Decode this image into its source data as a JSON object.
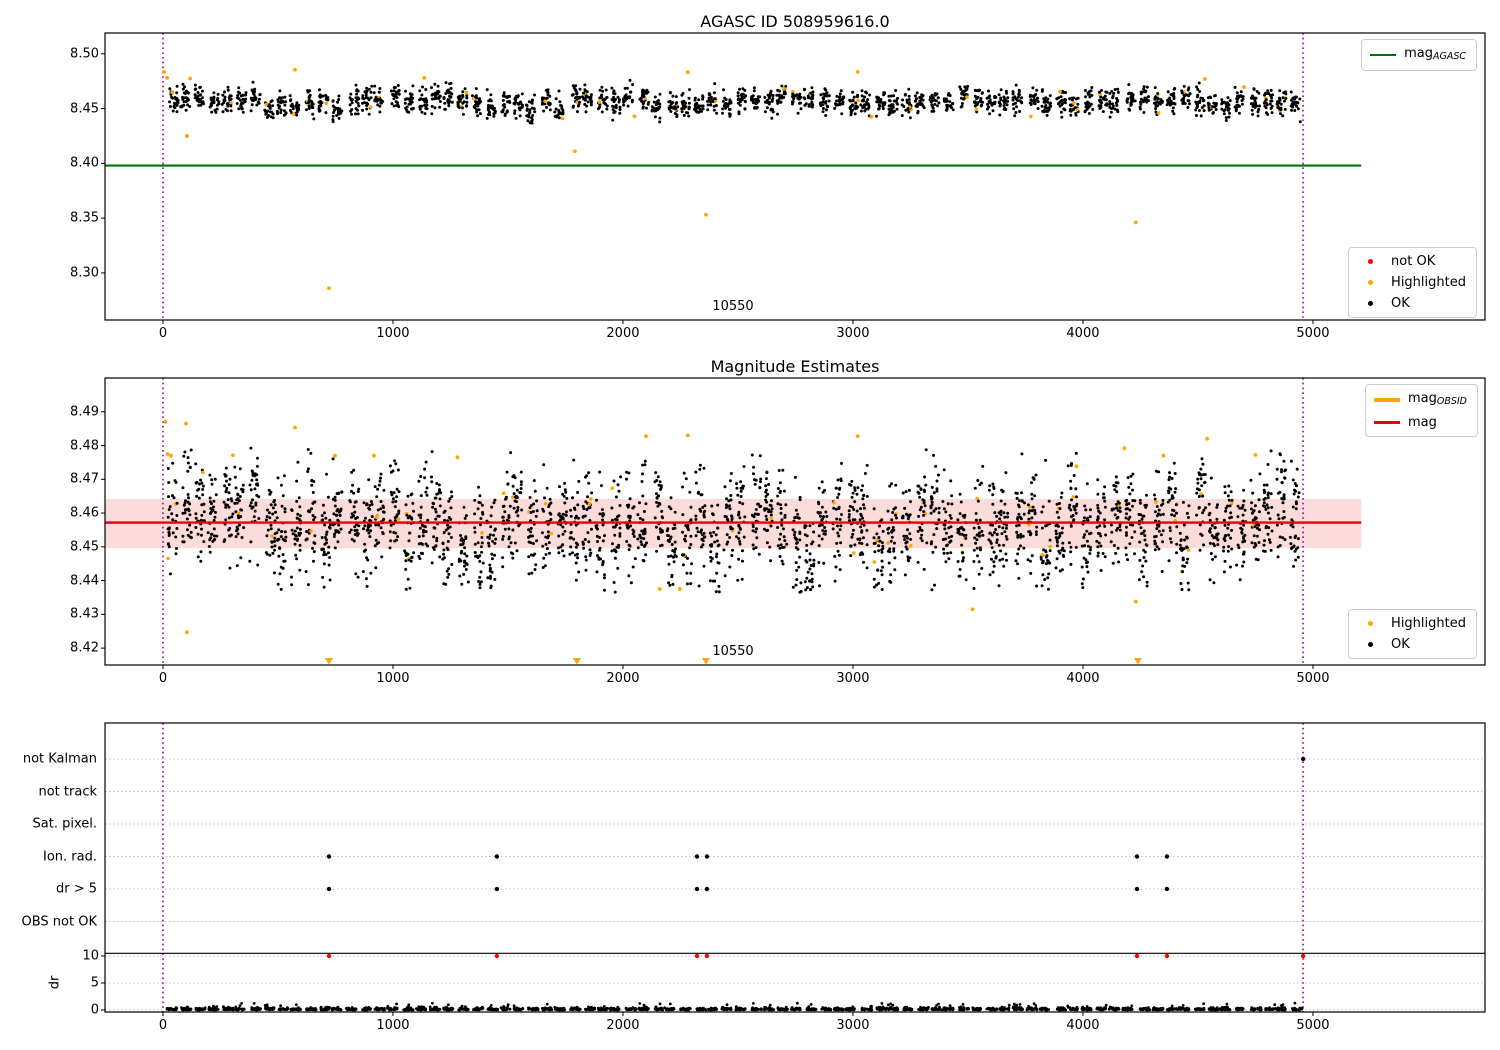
{
  "colors": {
    "ok": "#000000",
    "highlighted": "#ffa500",
    "not_ok": "#ff0000",
    "mag_agasc_line": "#007000",
    "mag_line": "#ee0000",
    "mag_obsid_line": "#ffa500",
    "band_fill": "#fbdcda",
    "vline": "#990099",
    "grid": "#bbbbbb"
  },
  "chart_data": [
    {
      "type": "scatter",
      "title": "AGASC ID 508959616.0",
      "xlim": [
        -252,
        5748
      ],
      "ylim": [
        8.257,
        8.519
      ],
      "xticks": [
        0,
        1000,
        2000,
        3000,
        4000,
        5000
      ],
      "yticks": [
        8.3,
        8.35,
        8.4,
        8.45,
        8.5
      ],
      "vlines": [
        0,
        4957
      ],
      "hline": {
        "y": 8.398,
        "x0": -252,
        "x1": 5210
      },
      "annotation": {
        "text": "10550",
        "x": 2480
      },
      "legend_top": [
        {
          "label": "mag",
          "sub": "AGASC"
        }
      ],
      "legend_bottom": [
        {
          "label": "not OK"
        },
        {
          "label": "Highlighted"
        },
        {
          "label": "OK"
        }
      ],
      "gen": {
        "seed": 421,
        "clusters": 82,
        "x0": 8,
        "x1": 4958,
        "per_cluster": 26,
        "mean": 8.456,
        "cluster_sd": 0.0028,
        "point_sd": 0.0058,
        "ymin": 8.436,
        "ymax": 8.492,
        "highlighted_frac": 0.016
      },
      "highlighted_points": [
        [
          104,
          8.425
        ],
        [
          722,
          8.286
        ],
        [
          1791,
          8.411
        ],
        [
          2361,
          8.353
        ],
        [
          4230,
          8.346
        ],
        [
          5,
          8.4835
        ],
        [
          18,
          8.478
        ],
        [
          40,
          8.465
        ],
        [
          118,
          8.4775
        ],
        [
          574,
          8.4855
        ],
        [
          1136,
          8.478
        ],
        [
          2282,
          8.4832
        ],
        [
          3020,
          8.4835
        ],
        [
          1320,
          8.4645
        ],
        [
          2700,
          8.468
        ],
        [
          3900,
          8.4655
        ],
        [
          4700,
          8.4695
        ],
        [
          2050,
          8.443
        ],
        [
          3080,
          8.4425
        ],
        [
          4530,
          8.477
        ]
      ]
    },
    {
      "type": "scatter",
      "title": "Magnitude Estimates",
      "xlim": [
        -252,
        5748
      ],
      "ylim": [
        8.415,
        8.5
      ],
      "xticks": [
        0,
        1000,
        2000,
        3000,
        4000,
        5000
      ],
      "yticks": [
        8.42,
        8.43,
        8.44,
        8.45,
        8.46,
        8.47,
        8.48,
        8.49
      ],
      "vlines": [
        0,
        4957
      ],
      "hline": {
        "y": 8.4572,
        "x0": -252,
        "x1": 5210
      },
      "band": {
        "y0": 8.4496,
        "y1": 8.4642,
        "x0": -252,
        "x1": 5210
      },
      "annotation": {
        "text": "10550",
        "x": 2480
      },
      "legend_top": [
        {
          "label": "mag",
          "sub": "OBSID"
        },
        {
          "label": "mag",
          "sub": ""
        }
      ],
      "legend_bottom": [
        {
          "label": "Highlighted"
        },
        {
          "label": "OK"
        }
      ],
      "clipped_low_x": [
        722,
        1800,
        2361,
        4239
      ],
      "gen": {
        "seed": 887,
        "clusters": 82,
        "x0": 8,
        "x1": 4958,
        "per_cluster": 34,
        "mean": 8.457,
        "cluster_sd": 0.0035,
        "point_sd": 0.0075,
        "ymin": 8.4365,
        "ymax": 8.4795,
        "highlighted_frac": 0.013
      },
      "highlighted_points": [
        [
          104,
          8.4247
        ],
        [
          100,
          8.4865
        ],
        [
          10,
          8.487
        ],
        [
          20,
          8.4775
        ],
        [
          35,
          8.477
        ],
        [
          574,
          8.4853
        ],
        [
          748,
          8.477
        ],
        [
          917,
          8.477
        ],
        [
          2100,
          8.4828
        ],
        [
          2282,
          8.483
        ],
        [
          3020,
          8.4828
        ],
        [
          2160,
          8.4375
        ],
        [
          2247,
          8.4375
        ],
        [
          3520,
          8.4315
        ],
        [
          4230,
          8.4338
        ],
        [
          4540,
          8.482
        ],
        [
          4750,
          8.4772
        ],
        [
          4350,
          8.477
        ],
        [
          1280,
          8.4765
        ],
        [
          4180,
          8.4792
        ]
      ]
    },
    {
      "type": "flags",
      "flag_labels": [
        "not Kalman",
        "not track",
        "Sat. pixel.",
        "Ion. rad.",
        "dr > 5",
        "OBS not OK"
      ],
      "dr_ticks": [
        10,
        5,
        0
      ],
      "dr_axis_label": "dr",
      "xticks": [
        0,
        1000,
        2000,
        3000,
        4000,
        5000
      ],
      "vlines": [
        0,
        4957
      ],
      "separator_dr": 10.5,
      "flag_points": {
        "Ion. rad.": [
          722,
          1452,
          2322,
          2365,
          4235,
          4365
        ],
        "dr > 5": [
          722,
          1452,
          2322,
          2365,
          4235,
          4365
        ],
        "not Kalman": [
          4957
        ]
      },
      "dr_capped_points": [
        722,
        1452,
        2322,
        2365,
        4235,
        4365,
        4957
      ],
      "gen": {
        "seed": 311,
        "clusters": 82,
        "x0": 8,
        "x1": 4958,
        "per_cluster": 26,
        "dr_sd": 0.22,
        "dr_max": 1.3
      }
    }
  ]
}
